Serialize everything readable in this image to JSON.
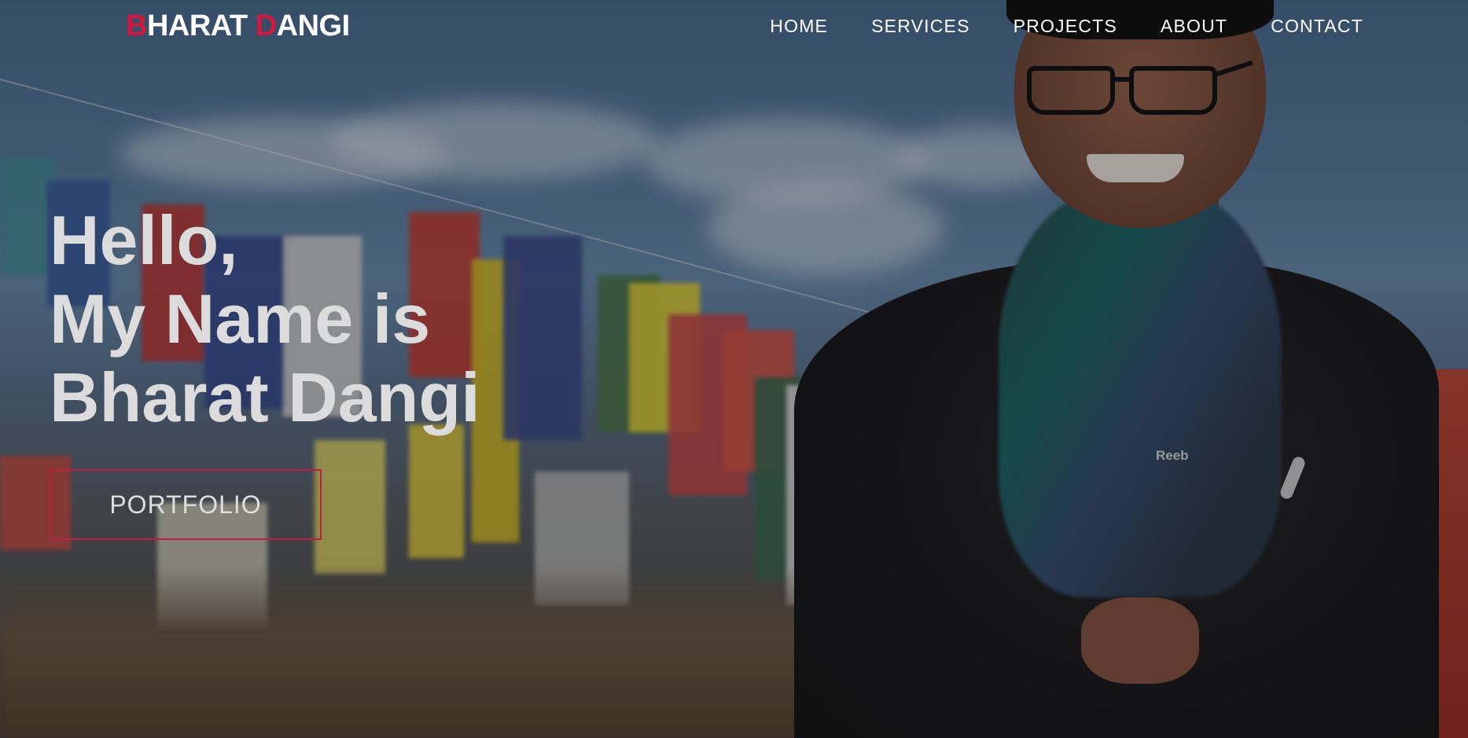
{
  "brand": {
    "initial_first": "B",
    "rest_first": "HARAT",
    "initial_last": "D",
    "rest_last": "ANGI"
  },
  "nav": {
    "items": [
      {
        "label": "HOME"
      },
      {
        "label": "SERVICES"
      },
      {
        "label": "PROJECTS"
      },
      {
        "label": "ABOUT"
      },
      {
        "label": "CONTACT"
      }
    ]
  },
  "hero": {
    "lines": [
      "Hello,",
      "My Name is",
      "Bharat Dangi"
    ],
    "button_label": "PORTFOLIO"
  },
  "photo": {
    "logo_text": "Reeb"
  },
  "colors": {
    "accent": "#d4173f",
    "button_border": "#c21c42",
    "nav_text": "#ffffff",
    "hero_text": "#dcdcdc"
  }
}
